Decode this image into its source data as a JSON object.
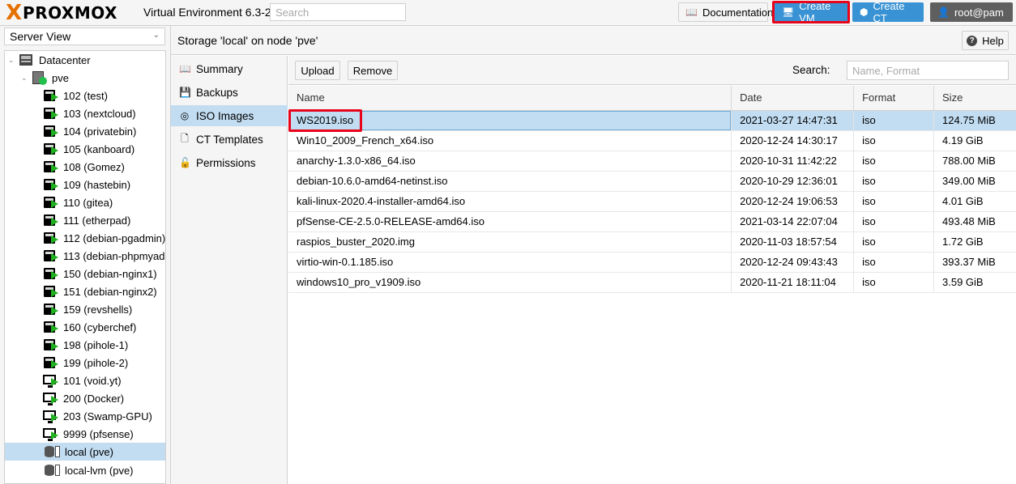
{
  "header": {
    "logo_x": "X",
    "logo_text": "PROXMOX",
    "version": "Virtual Environment 6.3-2",
    "search_placeholder": "Search",
    "documentation_label": "Documentation",
    "create_vm_label": "Create VM",
    "create_ct_label": "Create CT",
    "user_label": "root@pam"
  },
  "sidebar": {
    "view_label": "Server View",
    "datacenter": "Datacenter",
    "node": "pve",
    "vms": [
      {
        "label": "102 (test)",
        "kind": "ct-running"
      },
      {
        "label": "103 (nextcloud)",
        "kind": "ct-running"
      },
      {
        "label": "104 (privatebin)",
        "kind": "ct-running"
      },
      {
        "label": "105 (kanboard)",
        "kind": "ct-running"
      },
      {
        "label": "108 (Gomez)",
        "kind": "ct-running"
      },
      {
        "label": "109 (hastebin)",
        "kind": "ct-running"
      },
      {
        "label": "110 (gitea)",
        "kind": "ct-running"
      },
      {
        "label": "111 (etherpad)",
        "kind": "ct-running"
      },
      {
        "label": "112 (debian-pgadmin)",
        "kind": "ct-running"
      },
      {
        "label": "113 (debian-phpmyad",
        "kind": "ct-running"
      },
      {
        "label": "150 (debian-nginx1)",
        "kind": "ct-running"
      },
      {
        "label": "151 (debian-nginx2)",
        "kind": "ct-running"
      },
      {
        "label": "159 (revshells)",
        "kind": "ct-running"
      },
      {
        "label": "160 (cyberchef)",
        "kind": "ct-running"
      },
      {
        "label": "198 (pihole-1)",
        "kind": "ct-running"
      },
      {
        "label": "199 (pihole-2)",
        "kind": "ct-running"
      },
      {
        "label": "101 (void.yt)",
        "kind": "vm-running"
      },
      {
        "label": "200 (Docker)",
        "kind": "vm-running"
      },
      {
        "label": "203 (Swamp-GPU)",
        "kind": "vm-running"
      },
      {
        "label": "9999 (pfsense)",
        "kind": "vm-running"
      }
    ],
    "storages": [
      {
        "label": "local (pve)",
        "selected": true
      },
      {
        "label": "local-lvm (pve)",
        "selected": false
      }
    ]
  },
  "panel": {
    "title": "Storage 'local' on node 'pve'",
    "help_label": "Help",
    "menu": [
      {
        "label": "Summary",
        "icon": "book-icon",
        "active": false
      },
      {
        "label": "Backups",
        "icon": "floppy-icon",
        "active": false
      },
      {
        "label": "ISO Images",
        "icon": "disc-icon",
        "active": true
      },
      {
        "label": "CT Templates",
        "icon": "file-icon",
        "active": false
      },
      {
        "label": "Permissions",
        "icon": "unlock-icon",
        "active": false
      }
    ],
    "toolbar": {
      "upload_label": "Upload",
      "remove_label": "Remove",
      "search_label": "Search:",
      "search_placeholder": "Name, Format"
    },
    "table": {
      "headers": [
        "Name",
        "Date",
        "Format",
        "Size"
      ],
      "rows": [
        {
          "name": "WS2019.iso",
          "date": "2021-03-27 14:47:31",
          "format": "iso",
          "size": "124.75 MiB"
        },
        {
          "name": "Win10_2009_French_x64.iso",
          "date": "2020-12-24 14:30:17",
          "format": "iso",
          "size": "4.19 GiB"
        },
        {
          "name": "anarchy-1.3.0-x86_64.iso",
          "date": "2020-10-31 11:42:22",
          "format": "iso",
          "size": "788.00 MiB"
        },
        {
          "name": "debian-10.6.0-amd64-netinst.iso",
          "date": "2020-10-29 12:36:01",
          "format": "iso",
          "size": "349.00 MiB"
        },
        {
          "name": "kali-linux-2020.4-installer-amd64.iso",
          "date": "2020-12-24 19:06:53",
          "format": "iso",
          "size": "4.01 GiB"
        },
        {
          "name": "pfSense-CE-2.5.0-RELEASE-amd64.iso",
          "date": "2021-03-14 22:07:04",
          "format": "iso",
          "size": "493.48 MiB"
        },
        {
          "name": "raspios_buster_2020.img",
          "date": "2020-11-03 18:57:54",
          "format": "iso",
          "size": "1.72 GiB"
        },
        {
          "name": "virtio-win-0.1.185.iso",
          "date": "2020-12-24 09:43:43",
          "format": "iso",
          "size": "393.37 MiB"
        },
        {
          "name": "windows10_pro_v1909.iso",
          "date": "2020-11-21 18:11:04",
          "format": "iso",
          "size": "3.59 GiB"
        }
      ]
    }
  },
  "colors": {
    "accent": "#3892d4",
    "selection": "#c2ddf2",
    "highlight_box": "#e8051b",
    "logo_orange": "#e57000"
  }
}
